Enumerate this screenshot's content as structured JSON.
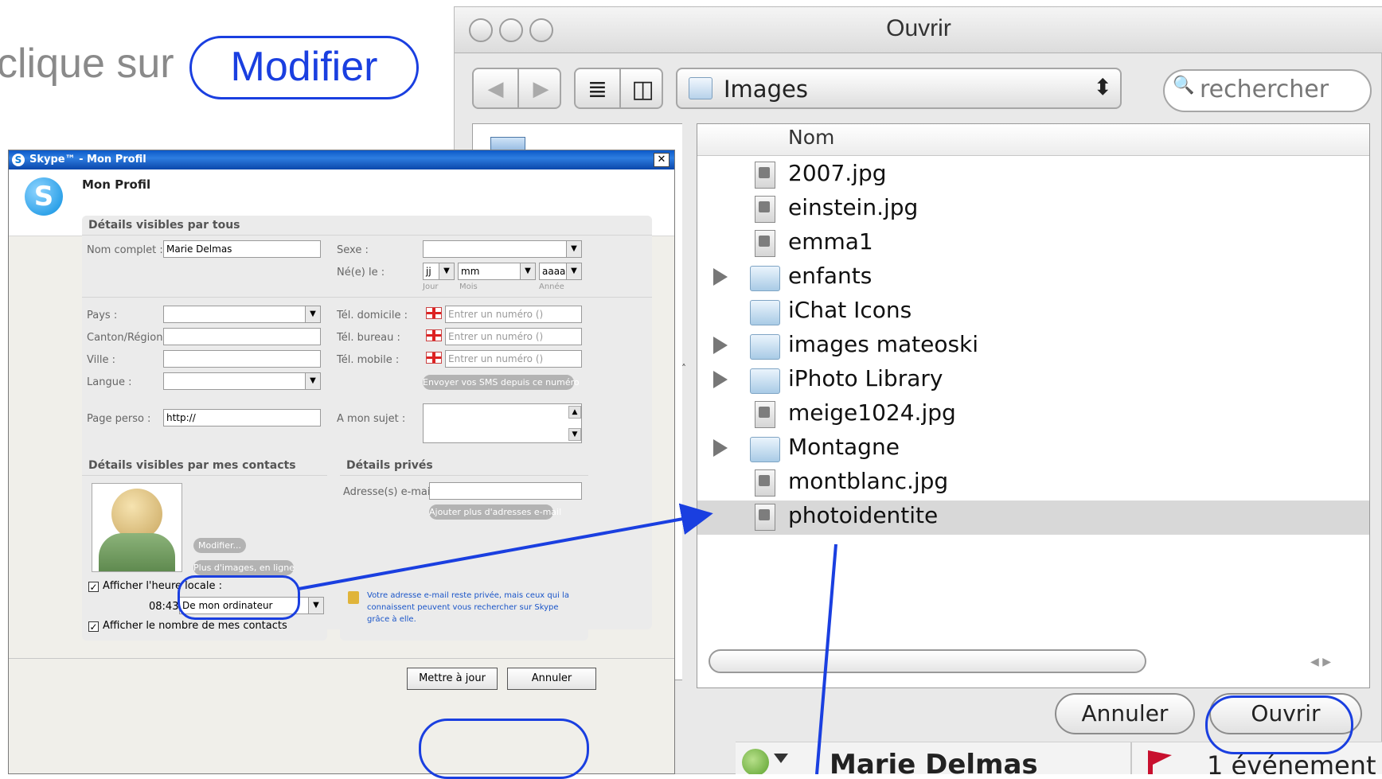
{
  "caption": {
    "prefix": "clique sur",
    "highlight": "Modifier"
  },
  "mac_dialog": {
    "title": "Ouvrir",
    "back_icon": "◀",
    "forward_icon": "▶",
    "list_view_icon": "≣",
    "column_view_icon": "◫",
    "location": "Images",
    "location_stepper": "⬍",
    "search_icon": "🔍",
    "search_placeholder": "rechercher",
    "column_header": "Nom",
    "files": [
      {
        "name": "2007.jpg",
        "type": "file"
      },
      {
        "name": "einstein.jpg",
        "type": "file"
      },
      {
        "name": "emma1",
        "type": "file"
      },
      {
        "name": "enfants",
        "type": "folder"
      },
      {
        "name": "iChat Icons",
        "type": "alias-folder"
      },
      {
        "name": "images mateoski",
        "type": "folder"
      },
      {
        "name": "iPhoto Library",
        "type": "folder"
      },
      {
        "name": "meige1024.jpg",
        "type": "file"
      },
      {
        "name": "Montagne",
        "type": "folder"
      },
      {
        "name": "montblanc.jpg",
        "type": "file"
      },
      {
        "name": "photoidentite",
        "type": "file",
        "selected": true
      }
    ],
    "cancel_label": "Annuler",
    "open_label": "Ouvrir",
    "scroll_left_icon": "◀",
    "scroll_right_icon": "▶"
  },
  "skype": {
    "title": "Skype™ - Mon Profil",
    "close_icon": "✕",
    "heading": "Mon Profil",
    "public": {
      "title": "Détails visibles par tous",
      "fullname_label": "Nom complet :",
      "fullname_value": "Marie Delmas",
      "sex_label": "Sexe :",
      "birth_label": "Né(e) le :",
      "day_value": "jj",
      "month_value": "mm",
      "year_value": "aaaa",
      "day_hint": "Jour",
      "month_hint": "Mois",
      "year_hint": "Année",
      "country_label": "Pays :",
      "region_label": "Canton/Région :",
      "city_label": "Ville :",
      "language_label": "Langue :",
      "home_phone_label": "Tél. domicile :",
      "office_phone_label": "Tél. bureau :",
      "mobile_phone_label": "Tél. mobile :",
      "phone_placeholder": "Entrer un numéro ()",
      "sms_button": "Envoyer vos SMS depuis ce numéro",
      "homepage_label": "Page perso :",
      "homepage_value": "http://",
      "about_label": "A mon sujet :"
    },
    "contacts": {
      "title": "Détails visibles par mes contacts",
      "modify_button": "Modifier...",
      "more_images_button": "Plus d'images, en ligne",
      "show_time_label": "Afficher l'heure locale :",
      "time_value": "08:43",
      "time_source": "De mon ordinateur",
      "show_contacts_label": "Afficher le nombre de mes contacts",
      "check_mark": "✓"
    },
    "private": {
      "title": "Détails privés",
      "email_label": "Adresse(s) e-mail :",
      "add_email_button": "Ajouter plus d'adresses e-mail",
      "privacy_note": "Votre adresse e-mail reste privée, mais ceux qui la connaissent peuvent vous rechercher sur Skype grâce à elle."
    },
    "update_button": "Mettre à jour",
    "cancel_button": "Annuler"
  },
  "bottom_strip": {
    "contact_name": "Marie Delmas",
    "events_text": "1 événement"
  },
  "colors": {
    "annotation": "#1a3fe0",
    "skype_title": "#0c59c8",
    "selection": "#d8d8d8"
  }
}
